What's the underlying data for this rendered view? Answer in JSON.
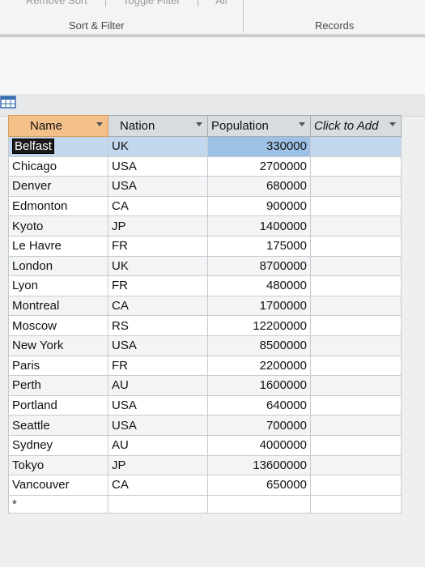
{
  "ribbon": {
    "top_items": [
      "Remove Sort",
      "Toggle Filter",
      "All"
    ],
    "groups": [
      "Sort & Filter",
      "Records"
    ]
  },
  "grid": {
    "columns": [
      "Name",
      "Nation",
      "Population",
      "Click to Add"
    ],
    "new_record_marker": "*",
    "rows": [
      {
        "name": "Belfast",
        "nation": "UK",
        "population": "330000"
      },
      {
        "name": "Chicago",
        "nation": "USA",
        "population": "2700000"
      },
      {
        "name": "Denver",
        "nation": "USA",
        "population": "680000"
      },
      {
        "name": "Edmonton",
        "nation": "CA",
        "population": "900000"
      },
      {
        "name": "Kyoto",
        "nation": "JP",
        "population": "1400000"
      },
      {
        "name": "Le Havre",
        "nation": "FR",
        "population": "175000"
      },
      {
        "name": "London",
        "nation": "UK",
        "population": "8700000"
      },
      {
        "name": "Lyon",
        "nation": "FR",
        "population": "480000"
      },
      {
        "name": "Montreal",
        "nation": "CA",
        "population": "1700000"
      },
      {
        "name": "Moscow",
        "nation": "RS",
        "population": "12200000"
      },
      {
        "name": "New York",
        "nation": "USA",
        "population": "8500000"
      },
      {
        "name": "Paris",
        "nation": "FR",
        "population": "2200000"
      },
      {
        "name": "Perth",
        "nation": "AU",
        "population": "1600000"
      },
      {
        "name": "Portland",
        "nation": "USA",
        "population": "640000"
      },
      {
        "name": "Seattle",
        "nation": "USA",
        "population": "700000"
      },
      {
        "name": "Sydney",
        "nation": "AU",
        "population": "4000000"
      },
      {
        "name": "Tokyo",
        "nation": "JP",
        "population": "13600000"
      },
      {
        "name": "Vancouver",
        "nation": "CA",
        "population": "650000"
      }
    ]
  }
}
